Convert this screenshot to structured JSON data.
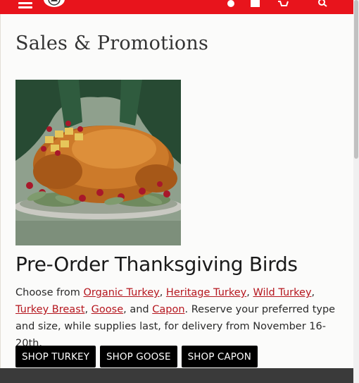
{
  "header": {
    "brand_color": "#e8141c",
    "icons": [
      "menu-icon",
      "logo",
      "account-icon",
      "document-icon",
      "cart-icon",
      "search-icon"
    ]
  },
  "page": {
    "title": "Sales & Promotions"
  },
  "promo": {
    "image_alt": "Roasted turkey on a platter",
    "title": "Pre-Order Thanksgiving Birds",
    "desc_1": "Choose from ",
    "link_organic": "Organic Turkey",
    "sep_1": ", ",
    "link_heritage": "Heritage Turkey",
    "sep_2": ", ",
    "link_wild": "Wild Turkey",
    "sep_3": ", ",
    "link_breast": "Turkey Breast",
    "sep_4": ", ",
    "link_goose": "Goose",
    "sep_5": ", and ",
    "link_capon": "Capon",
    "desc_2": ". Reserve your preferred type and size, while supplies last, for delivery from November 16-20th.",
    "link_color": "#b5161e"
  },
  "buttons": {
    "shop_turkey": "SHOP TURKEY",
    "shop_goose": "SHOP GOOSE",
    "shop_capon": "SHOP CAPON"
  }
}
